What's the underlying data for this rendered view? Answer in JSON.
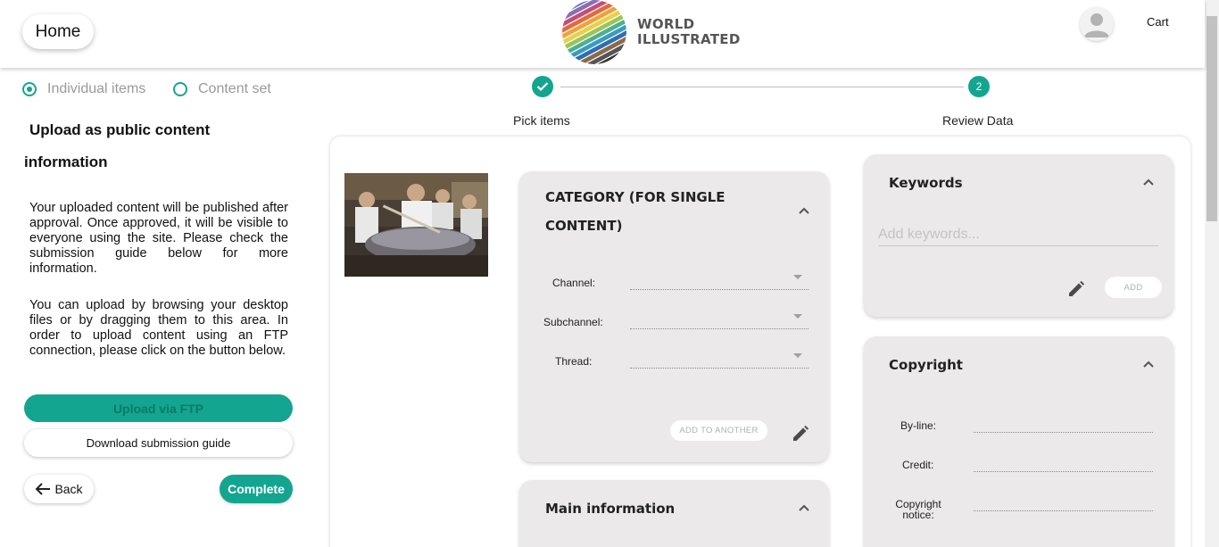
{
  "header": {
    "home_label": "Home",
    "logo_line1": "WORLD",
    "logo_line2": "ILLUSTRATED",
    "cart_label": "Cart"
  },
  "mode": {
    "options": [
      {
        "label": "Individual items",
        "selected": true
      },
      {
        "label": "Content set",
        "selected": false
      }
    ]
  },
  "sidebar": {
    "title_line1": "Upload as public content",
    "title_line2": "information",
    "paragraph1": "Your uploaded content will be published after approval. Once approved, it will be visible to everyone using the site. Please check the submission guide below for more information.",
    "paragraph2": "You can upload by browsing your desktop files or by dragging them to this area. In order to upload content using an FTP connection, please click on the button below.",
    "ftp_button": "Upload via FTP",
    "guide_button": "Download submission guide",
    "back_button": "Back",
    "complete_button": "Complete"
  },
  "stepper": {
    "steps": [
      {
        "label": "Pick items",
        "status": "done"
      },
      {
        "label": "Review Data",
        "number": "2",
        "status": "active"
      }
    ]
  },
  "category_panel": {
    "title_line1": "CATEGORY (FOR SINGLE",
    "title_line2": "CONTENT)",
    "channel_label": "Channel:",
    "subchannel_label": "Subchannel:",
    "thread_label": "Thread:",
    "add_to_another": "ADD TO ANOTHER"
  },
  "main_info_panel": {
    "title": "Main information"
  },
  "keywords_panel": {
    "title": "Keywords",
    "placeholder": "Add keywords...",
    "add_button": "ADD"
  },
  "copyright_panel": {
    "title": "Copyright",
    "byline_label": "By-line:",
    "credit_label": "Credit:",
    "notice_line1": "Copyright",
    "notice_line2": "notice:"
  },
  "colors": {
    "accent": "#13a58f",
    "panel_bg": "#ebe9ea"
  },
  "icons": [
    "avatar-icon",
    "check-icon",
    "arrow-left-icon",
    "chevron-up-icon",
    "pencil-icon",
    "dropdown-arrow-icon"
  ]
}
